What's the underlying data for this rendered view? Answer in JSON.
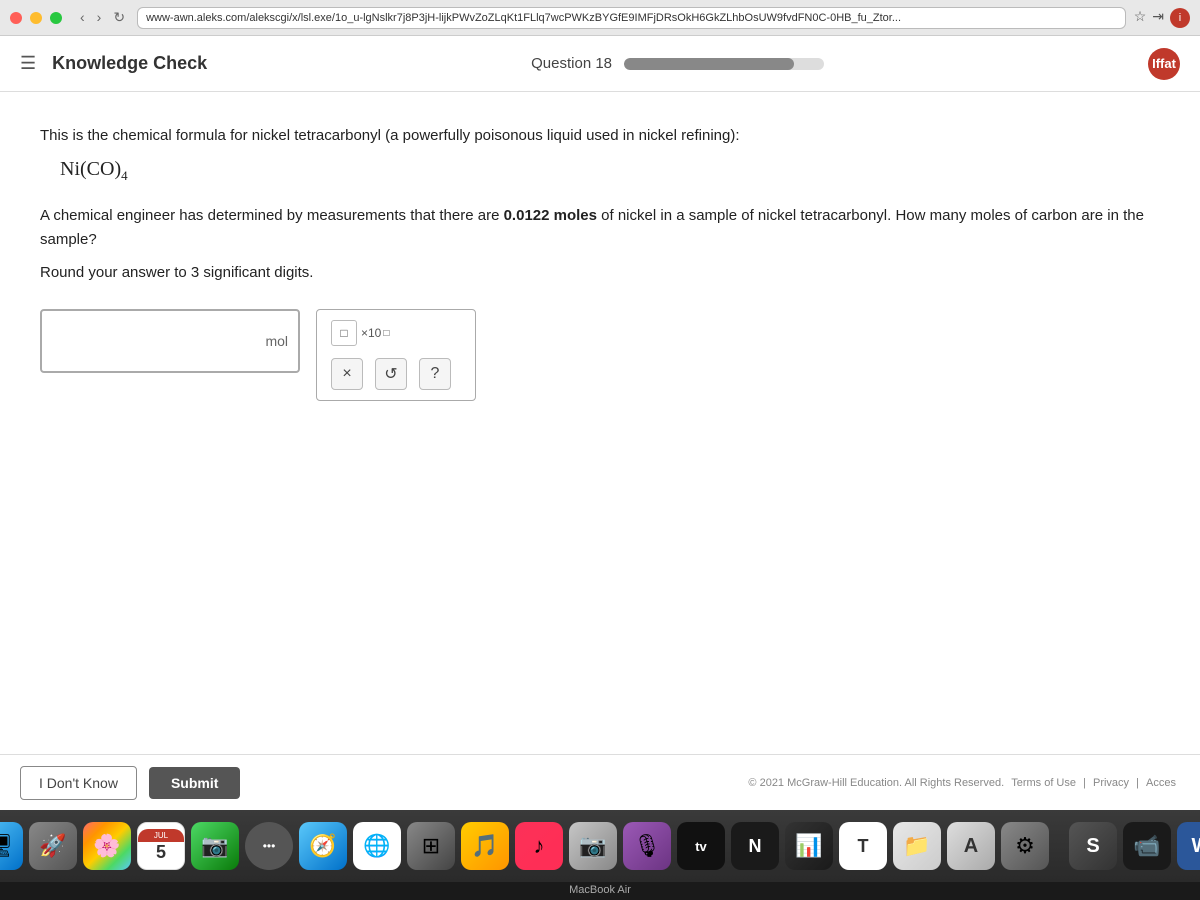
{
  "browser": {
    "url": "www-awn.aleks.com/alekscgi/x/lsl.exe/1o_u-lgNslkr7j8P3jH-lijkPWvZoZLqKt1FLlq7wcPWKzBYGfE9IMFjDRsOkH6GkZLhbOsUW9fvdFN0C-0HB_fu_Ztor..."
  },
  "header": {
    "menu_icon": "☰",
    "title": "Knowledge Check",
    "question_label": "Question 18",
    "progress_percent": 85,
    "user_initials": "Iffat"
  },
  "question": {
    "intro": "This is the chemical formula for nickel tetracarbonyl (a powerfully poisonous liquid used in nickel refining):",
    "formula_text": "Ni(CO)",
    "formula_subscript": "4",
    "body": "A chemical engineer has determined by measurements that there are 0.0122 moles of nickel in a sample of nickel tetracarbonyl. How many moles of carbon are in the sample?",
    "round_note": "Round your answer to 3 significant digits.",
    "input_placeholder": "",
    "unit": "mol"
  },
  "keypad": {
    "sci_notation_label": "×10",
    "btn_x": "×",
    "btn_undo": "↺",
    "btn_help": "?"
  },
  "footer": {
    "dont_know": "I Don't Know",
    "submit": "Submit",
    "copyright": "© 2021 McGraw-Hill Education. All Rights Reserved.",
    "terms": "Terms of Use",
    "privacy": "Privacy",
    "access": "Acces"
  },
  "dock": {
    "label": "MacBook Air",
    "calendar_month": "JUL",
    "calendar_day": "5"
  }
}
